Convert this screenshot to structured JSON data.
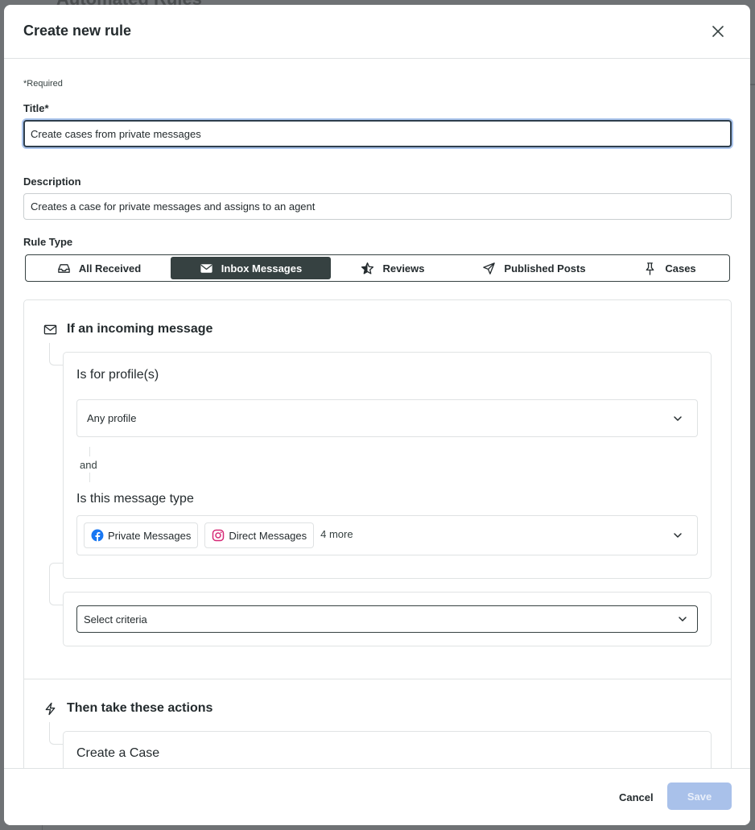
{
  "backdrop": {
    "page_title": "Automated Rules"
  },
  "modal": {
    "title": "Create new rule"
  },
  "form": {
    "required_note": "*Required",
    "title_label": "Title*",
    "title_value": "Create cases from private messages",
    "description_label": "Description",
    "description_value": "Creates a case for private messages and assigns to an agent",
    "rule_type_label": "Rule Type"
  },
  "rule_types": [
    {
      "label": "All Received",
      "icon": "inbox-tray-icon",
      "active": false
    },
    {
      "label": "Inbox Messages",
      "icon": "envelope-icon",
      "active": true
    },
    {
      "label": "Reviews",
      "icon": "star-icon",
      "active": false
    },
    {
      "label": "Published Posts",
      "icon": "paper-plane-icon",
      "active": false
    },
    {
      "label": "Cases",
      "icon": "pushpin-icon",
      "active": false
    }
  ],
  "trigger": {
    "heading": "If an incoming message",
    "icon": "envelope-icon",
    "profile_condition": {
      "title": "Is for profile(s)",
      "selected": "Any profile"
    },
    "connector": "and",
    "message_type_condition": {
      "title": "Is this message type",
      "chips": [
        {
          "label": "Private Messages",
          "icon": "facebook-icon",
          "color": "#1877f2"
        },
        {
          "label": "Direct Messages",
          "icon": "instagram-icon",
          "color": "#d62976"
        }
      ],
      "more": "4 more"
    },
    "criteria_placeholder": "Select criteria"
  },
  "actions": {
    "heading": "Then take these actions",
    "icon": "lightning-icon",
    "first_action": "Create a Case"
  },
  "footer": {
    "cancel_label": "Cancel",
    "save_label": "Save"
  },
  "colors": {
    "primary_dark": "#364141",
    "save_disabled": "#a9c1ea",
    "focus_ring": "#aac4ec"
  }
}
